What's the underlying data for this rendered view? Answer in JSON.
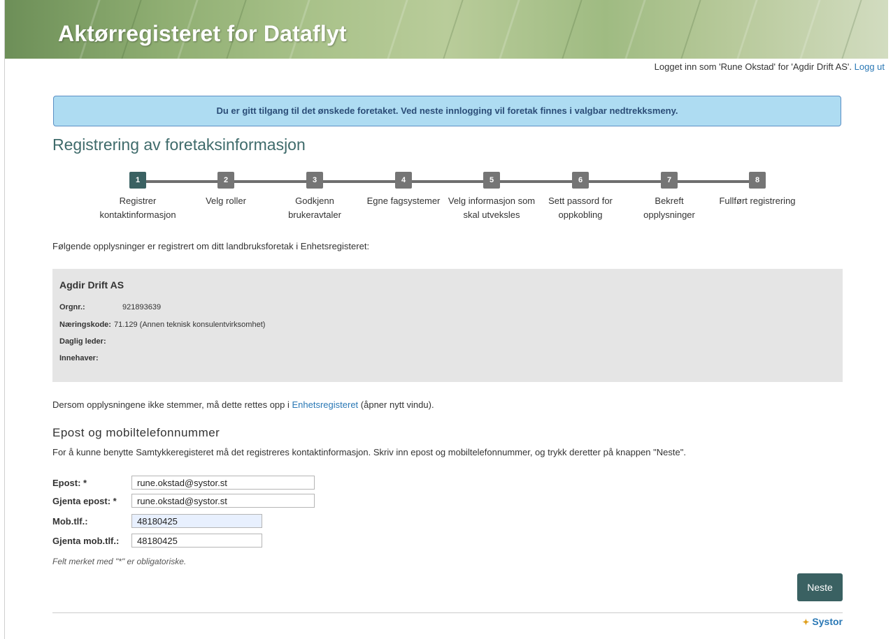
{
  "banner": {
    "title": "Aktørregisteret for Dataflyt"
  },
  "login": {
    "text": "Logget inn som 'Rune Okstad' for 'Agdir Drift AS'. ",
    "logout": "Logg ut"
  },
  "alert": {
    "text": "Du er gitt tilgang til det ønskede foretaket. Ved neste innlogging vil foretak finnes i valgbar nedtrekksmeny."
  },
  "page_title": "Registrering av foretaksinformasjon",
  "steps": [
    {
      "num": "1",
      "label": "Registrer kontaktinformasjon",
      "active": true
    },
    {
      "num": "2",
      "label": "Velg roller"
    },
    {
      "num": "3",
      "label": "Godkjenn brukeravtaler"
    },
    {
      "num": "4",
      "label": "Egne fagsystemer"
    },
    {
      "num": "5",
      "label": "Velg informasjon som skal utveksles"
    },
    {
      "num": "6",
      "label": "Sett passord for oppkobling"
    },
    {
      "num": "7",
      "label": "Bekreft opplysninger"
    },
    {
      "num": "8",
      "label": "Fullført registrering"
    }
  ],
  "intro": "Følgende opplysninger er registrert om ditt landbruksforetak i Enhetsregisteret:",
  "company": {
    "name": "Agdir Drift AS",
    "orgnr_label": "Orgnr.:",
    "orgnr": "921893639",
    "naering_label": "Næringskode:",
    "naering": "71.129 (Annen teknisk konsulentvirksomhet)",
    "leder_label": "Daglig leder:",
    "leder": "",
    "innehaver_label": "Innehaver:",
    "innehaver": ""
  },
  "correction": {
    "before": "Dersom opplysningene ikke stemmer, må dette rettes opp i ",
    "link": "Enhetsregisteret",
    "after": " (åpner nytt vindu)."
  },
  "contact": {
    "title": "Epost og mobiltelefonnummer",
    "desc": "For å kunne benytte Samtykkeregisteret må det registreres kontaktinformasjon. Skriv inn epost og mobiltelefonnummer, og trykk deretter på knappen \"Neste\".",
    "email_label": "Epost: *",
    "email_value": "rune.okstad@systor.st",
    "email2_label": "Gjenta epost: *",
    "email2_value": "rune.okstad@systor.st",
    "mob_label": "Mob.tlf.:",
    "mob_value": "48180425",
    "mob2_label": "Gjenta mob.tlf.:",
    "mob2_value": "48180425",
    "note": "Felt merket med \"*\" er obligatoriske."
  },
  "buttons": {
    "next": "Neste"
  },
  "footer": {
    "brand": "Systor"
  }
}
